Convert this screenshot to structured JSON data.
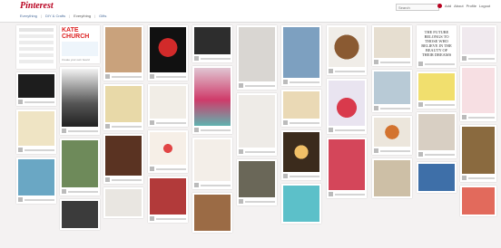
{
  "app": {
    "logo": "Pinterest"
  },
  "search": {
    "placeholder": "Search"
  },
  "nav": {
    "items": [
      "Add",
      "About",
      "Profile",
      "Logout"
    ]
  },
  "breadcrumb": {
    "items": [
      "Everything",
      "DIY & Crafts",
      "Everything",
      "Gifts"
    ]
  },
  "ad": {
    "headline": "KATE CHURCH",
    "sub": "Create your own board"
  },
  "quote": {
    "text": "THE FUTURE BELONGS TO THOSE WHO BELIEVE IN THE BEAUTY OF THEIR DREAMS"
  },
  "colors": {
    "brand": "#b8001f",
    "link": "#4a6c9b"
  }
}
